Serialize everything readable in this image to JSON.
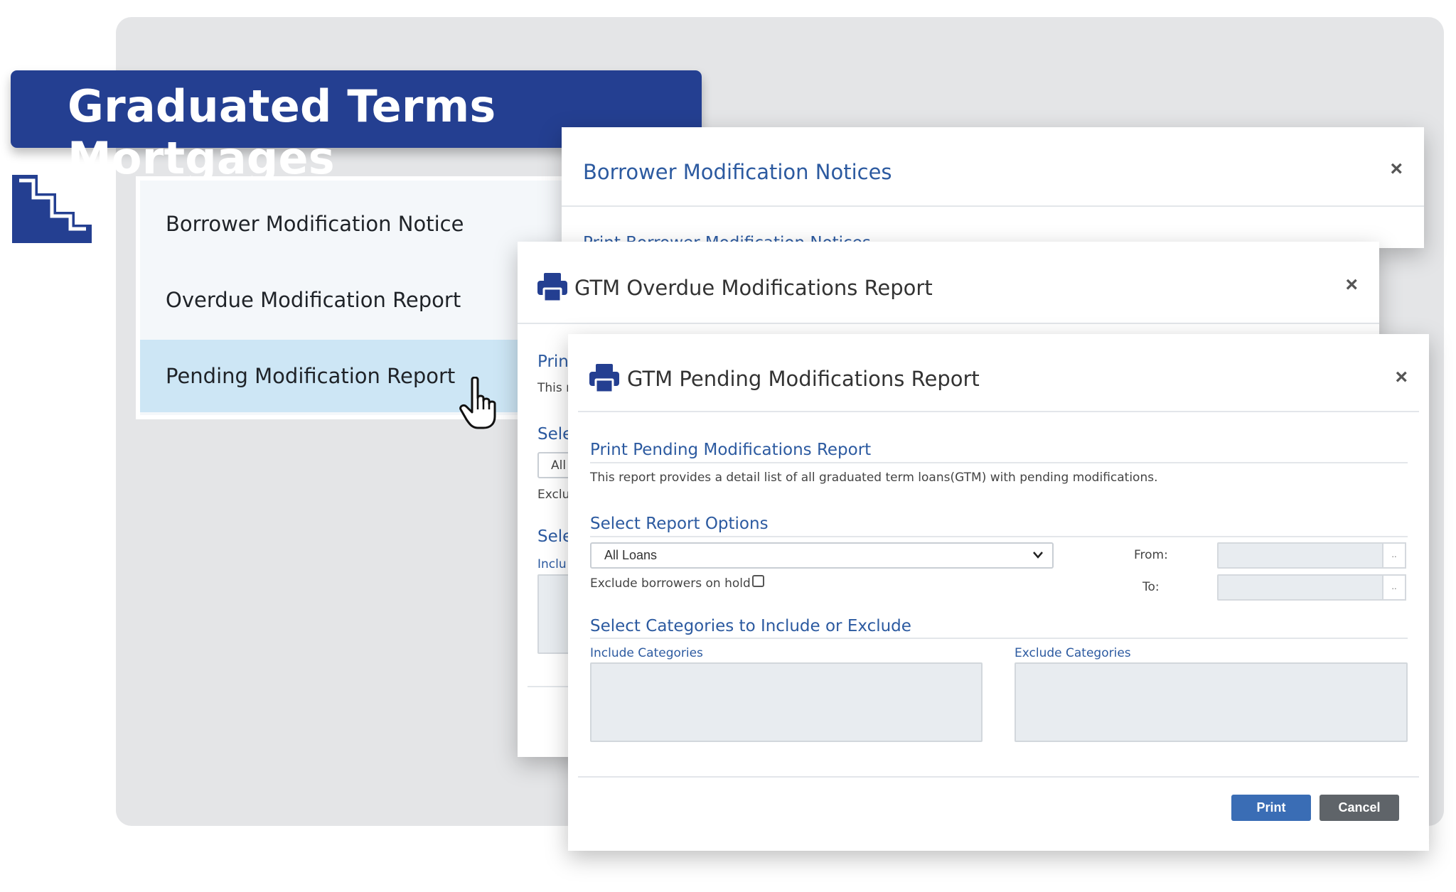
{
  "banner": {
    "title": "Graduated Terms Mortgages"
  },
  "menu": {
    "items": [
      {
        "label": "Borrower Modification Notice"
      },
      {
        "label": "Overdue Modification Report"
      },
      {
        "label": "Pending Modification Report"
      }
    ]
  },
  "notices_modal": {
    "title": "Borrower Modification Notices",
    "section_partial": "Print Borrower Modification Notices",
    "close": "×"
  },
  "overdue_modal": {
    "title": "GTM Overdue Modifications Report",
    "close": "×",
    "fragments": {
      "print": "Prin",
      "this": "This r",
      "sele1": "Sele",
      "all": "All",
      "exclu": "Exclu",
      "sele2": "Sele",
      "inclu": "Inclu"
    }
  },
  "pending_modal": {
    "title": "GTM Pending Modifications Report",
    "close": "×",
    "print_heading": "Print Pending Modifications Report",
    "description": "This report provides a detail list of all graduated term loans(GTM) with pending modifications.",
    "options_heading": "Select Report Options",
    "loan_select": {
      "value": "All Loans"
    },
    "from_label": "From:",
    "to_label": "To:",
    "date_button": "..",
    "exclude_hold_label": "Exclude borrowers on hold",
    "categories_heading": "Select Categories to Include or Exclude",
    "include_label": "Include Categories",
    "exclude_label": "Exclude Categories",
    "print_button": "Print",
    "cancel_button": "Cancel"
  },
  "colors": {
    "banner": "#243f91",
    "heading_blue": "#2c5aa0",
    "selected_item": "#cde6f5",
    "print_button": "#3a6db5",
    "cancel_button": "#5f6469"
  },
  "icons": [
    "stairs-icon",
    "printer-icon",
    "close-icon",
    "hand-cursor-icon",
    "chevron-down-icon"
  ]
}
